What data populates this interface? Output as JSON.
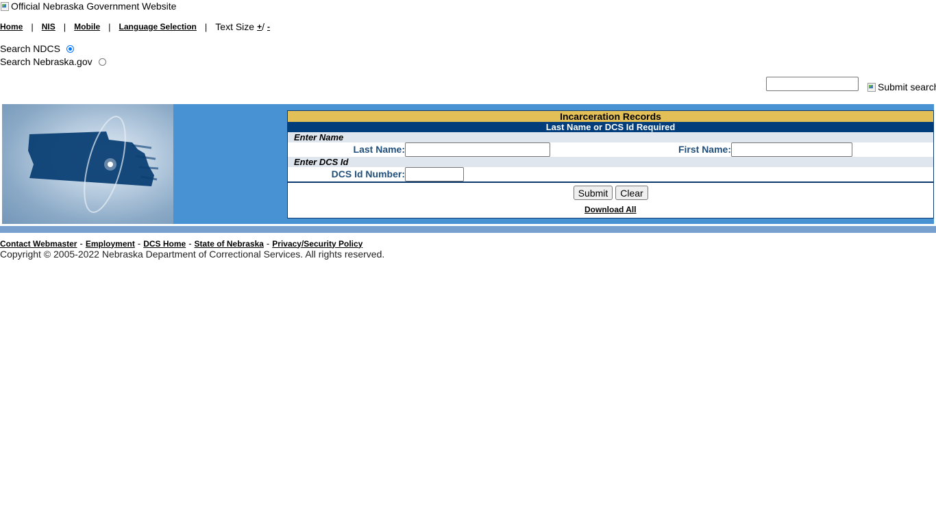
{
  "header": {
    "logo_alt": "Official Nebraska Government Website"
  },
  "nav": {
    "home": "Home",
    "nis": "NIS",
    "mobile": "Mobile",
    "language": "Language Selection",
    "separator": "|",
    "text_size_label": "Text Size",
    "text_size_plus": "+",
    "text_size_slash": "/",
    "text_size_minus": "-"
  },
  "search": {
    "option_ndcs": "Search NDCS",
    "option_nebraska": "Search Nebraska.gov",
    "selected": "Search NDCS",
    "query": "",
    "submit_alt": "Submit search"
  },
  "form": {
    "title": "Incarceration Records",
    "subtitle": "Last Name or DCS Id Required",
    "section_name": "Enter Name",
    "last_name_label": "Last Name:",
    "last_name_value": "",
    "first_name_label": "First Name:",
    "first_name_value": "",
    "section_dcs": "Enter DCS Id",
    "dcs_label": "DCS Id Number:",
    "dcs_value": "",
    "submit_label": "Submit",
    "clear_label": "Clear",
    "download_label": "Download All"
  },
  "footer": {
    "links": [
      "Contact Webmaster",
      "Employment",
      "DCS Home",
      "State of Nebraska",
      "Privacy/Security Policy"
    ],
    "separator": "-",
    "copyright": "Copyright © 2005-2022 Nebraska Department of Correctional Services. All rights reserved."
  },
  "colors": {
    "banner_blue": "#4891d3",
    "title_gold": "#e3bf58",
    "subtitle_navy": "#003d7a",
    "section_gray": "#dfe6ee",
    "label_blue": "#1f4e7a",
    "footer_bar": "#78a0cf"
  }
}
